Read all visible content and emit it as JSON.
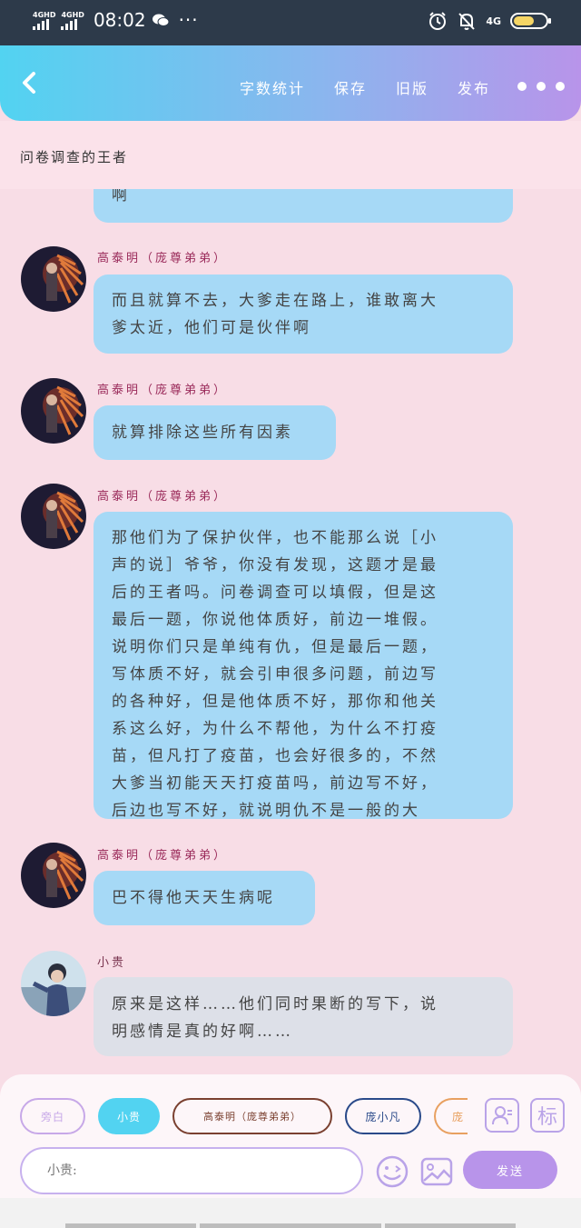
{
  "status_bar": {
    "signal1": "4GHD",
    "signal2": "4GHD",
    "time": "08:02",
    "more": "···",
    "network": "4G"
  },
  "header": {
    "back_icon": "chevron-left",
    "menu": [
      "字数统计",
      "保存",
      "旧版",
      "发布"
    ],
    "more_icon": "more-dots"
  },
  "subtitle": "问卷调查的王者",
  "messages": [
    {
      "sender": "",
      "lines": [
        "啊"
      ]
    },
    {
      "sender": "高泰明（庞尊弟弟）",
      "lines": [
        "而且就算不去，大爹走在路上，谁敢离大",
        "爹太近，他们可是伙伴啊"
      ]
    },
    {
      "sender": "高泰明（庞尊弟弟）",
      "lines": [
        "就算排除这些所有因素"
      ]
    },
    {
      "sender": "高泰明（庞尊弟弟）",
      "lines": [
        "那他们为了保护伙伴，也不能那么说［小",
        "声的说］爷爷，你没有发现，这题才是最",
        "后的王者吗。问卷调查可以填假，但是这",
        "最后一题，你说他体质好，前边一堆假。",
        "说明你们只是单纯有仇，但是最后一题，",
        "写体质不好，就会引申很多问题，前边写",
        "的各种好，但是他体质不好，那你和他关",
        "系这么好，为什么不帮他，为什么不打疫",
        "苗，但凡打了疫苗，也会好很多的，不然",
        "大爹当初能天天打疫苗吗，前边写不好，",
        "后边也写不好，就说明仇不是一般的大"
      ]
    },
    {
      "sender": "高泰明（庞尊弟弟）",
      "lines": [
        "巴不得他天天生病呢"
      ]
    },
    {
      "sender": "小贵",
      "lines": [
        "原来是这样……他们同时果断的写下，说",
        "明感情是真的好啊……"
      ]
    }
  ],
  "roles": [
    "旁白",
    "小贵",
    "高泰明（庞尊弟弟）",
    "庞小凡",
    "庞"
  ],
  "input": {
    "placeholder": "小贵:"
  },
  "send_label": "发送",
  "tag_icon_label": "标",
  "colors": {
    "background": "#f8dde6",
    "header_start": "#52d3f1",
    "header_end": "#b894ea",
    "bubble_blue": "#a6d9f6",
    "bubble_grey": "#dde0e8",
    "name_color": "#9a2a5a",
    "accent": "#b894ea"
  }
}
